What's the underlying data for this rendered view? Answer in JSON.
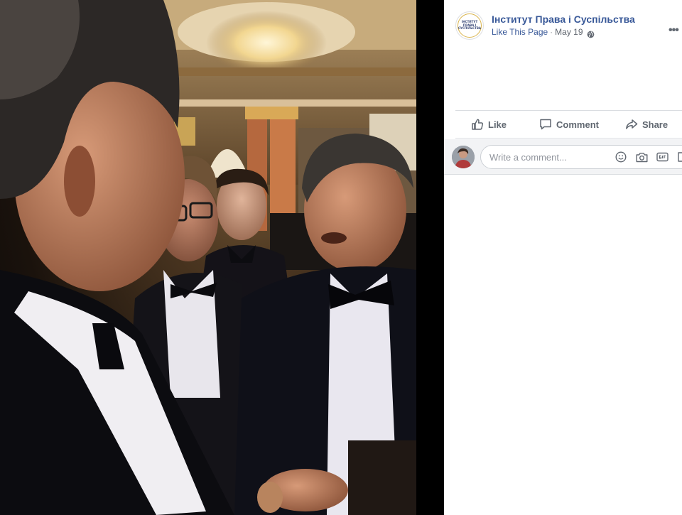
{
  "post": {
    "page_name": "Інститут Права і Суспільства",
    "like_page_label": "Like This Page",
    "separator": "·",
    "date": "May 19",
    "audience_icon": "globe-icon",
    "more_icon": "more-options-icon",
    "avatar_logo_text": "ІНСТИТУТ ПРАВА І СУСПІЛЬСТВА"
  },
  "actions": {
    "like_label": "Like",
    "comment_label": "Comment",
    "share_label": "Share"
  },
  "comment": {
    "placeholder": "Write a comment...",
    "icons": [
      "emoji-icon",
      "camera-icon",
      "gif-icon",
      "sticker-icon"
    ]
  },
  "colors": {
    "link_blue": "#385898",
    "action_gray": "#606770",
    "divider": "#dadde1",
    "comment_bg": "#f2f3f5",
    "logo_gold": "#d9b34a"
  }
}
